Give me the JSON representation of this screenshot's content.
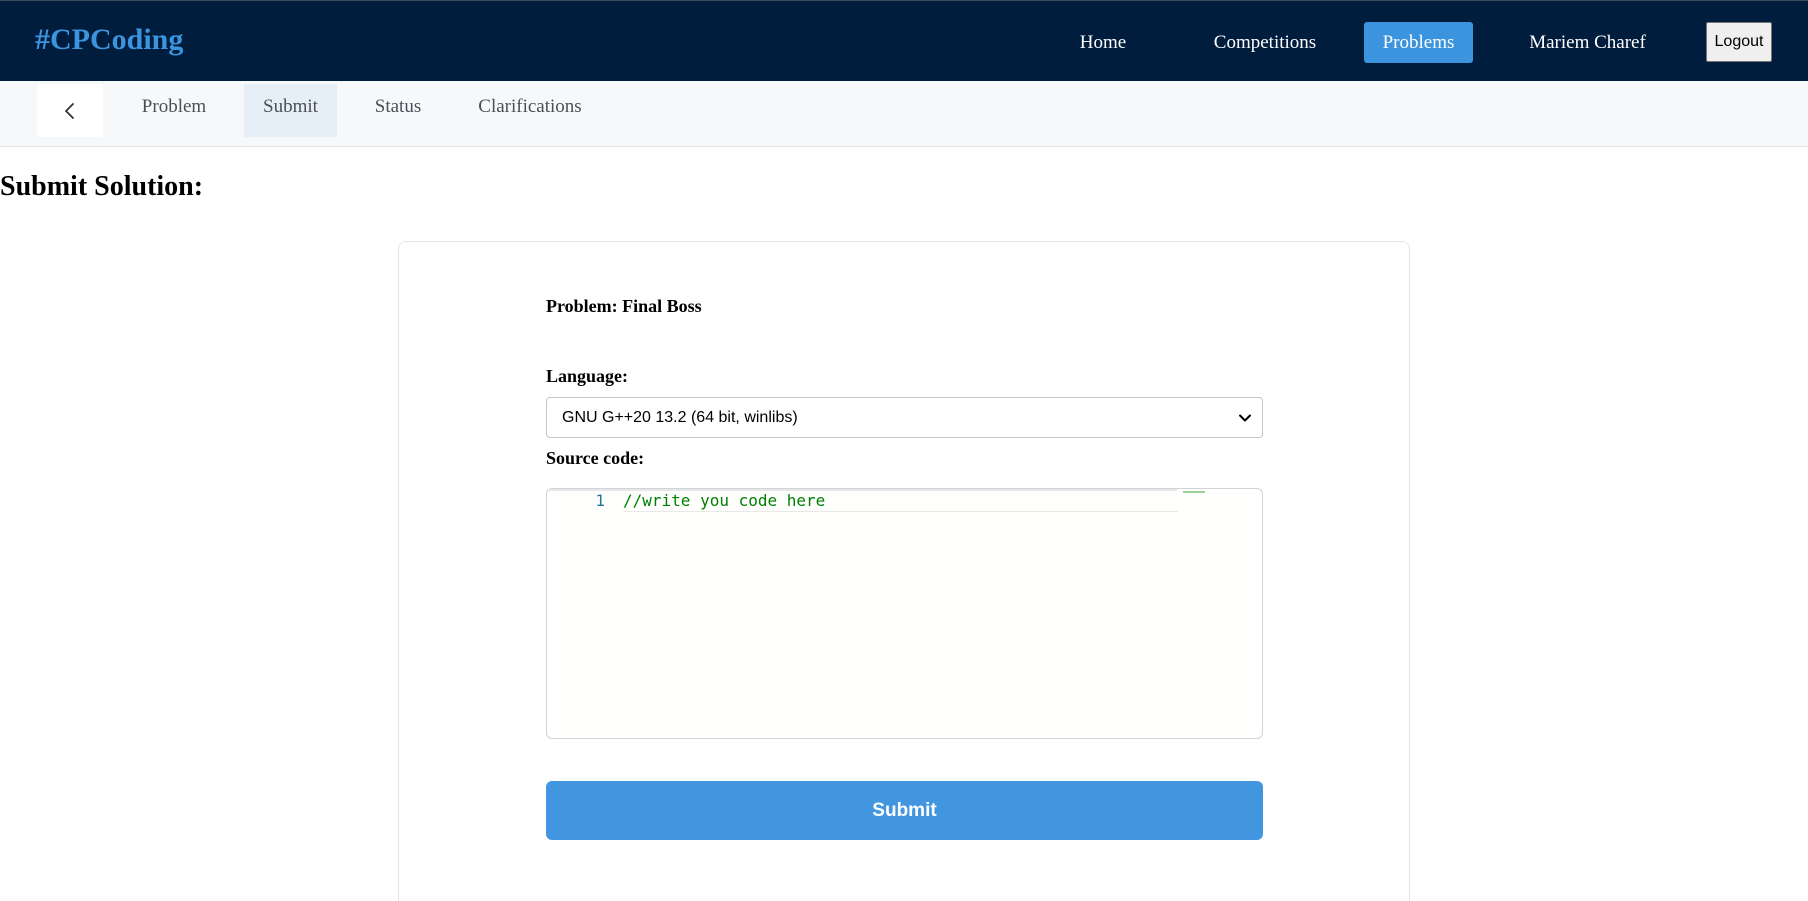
{
  "header": {
    "brand": "#CPCoding",
    "nav": {
      "home": "Home",
      "competitions": "Competitions",
      "problems": "Problems",
      "user": "Mariem Charef"
    },
    "logout_label": "Logout",
    "colors": {
      "background": "#011d3d",
      "accent": "#3b94dd"
    }
  },
  "subnav": {
    "back_icon": "chevron-left-icon",
    "tabs": [
      {
        "label": "Problem",
        "active": false
      },
      {
        "label": "Submit",
        "active": true
      },
      {
        "label": "Status",
        "active": false
      },
      {
        "label": "Clarifications",
        "active": false
      }
    ]
  },
  "main": {
    "title": "Submit Solution:",
    "problem_text": "Problem: Final Boss",
    "language_label": "Language:",
    "language_selected": "GNU G++20 13.2 (64 bit, winlibs)",
    "source_label": "Source code:",
    "editor": {
      "line_numbers": [
        "1"
      ],
      "lines": [
        "//write you code here"
      ]
    },
    "submit_label": "Submit",
    "submit_color": "#4296e0"
  }
}
